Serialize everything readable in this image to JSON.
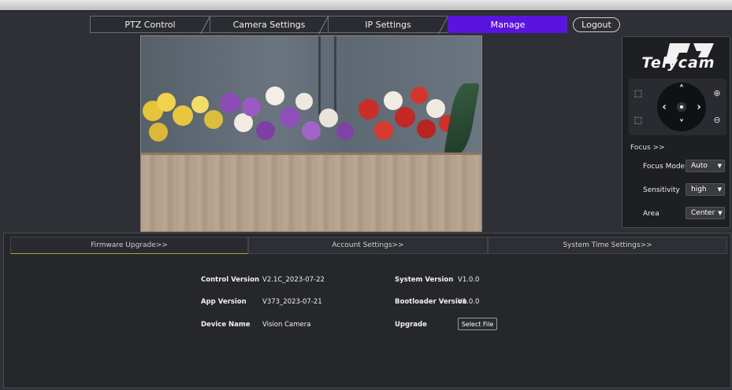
{
  "nav": {
    "tabs": [
      {
        "label": "PTZ Control"
      },
      {
        "label": "Camera Settings"
      },
      {
        "label": "IP Settings"
      },
      {
        "label": "Manage"
      }
    ],
    "active_tab": "Manage",
    "logout_label": "Logout",
    "active_color": "#5a14e0"
  },
  "brand": {
    "name": "Telycam"
  },
  "ptz": {
    "icons": [
      "arrow-up-icon",
      "arrow-down-icon",
      "arrow-left-icon",
      "arrow-right-icon",
      "home-center-icon",
      "zoom-in-icon",
      "zoom-out-icon",
      "fullscreen-icon",
      "fit-icon"
    ]
  },
  "focus": {
    "title": "Focus >>",
    "mode_label": "Focus Mode",
    "mode_value": "Auto",
    "sensitivity_label": "Sensitivity",
    "sensitivity_value": "high",
    "area_label": "Area",
    "area_value": "Center"
  },
  "manage": {
    "tabs": [
      {
        "label": "Firmware Upgrade>>"
      },
      {
        "label": "Account Settings>>"
      },
      {
        "label": "System Time Settings>>"
      }
    ],
    "active_tab": "Firmware Upgrade>>",
    "fields": {
      "control_version_label": "Control Version",
      "control_version_value": "V2.1C_2023-07-22",
      "app_version_label": "App Version",
      "app_version_value": "V373_2023-07-21",
      "device_name_label": "Device Name",
      "device_name_value": "Vision Camera",
      "system_version_label": "System Version",
      "system_version_value": "V1.0.0",
      "bootloader_version_label": "Bootloader Version",
      "bootloader_version_value": "V1.0.0",
      "upgrade_label": "Upgrade",
      "select_file_label": "Select File"
    }
  }
}
